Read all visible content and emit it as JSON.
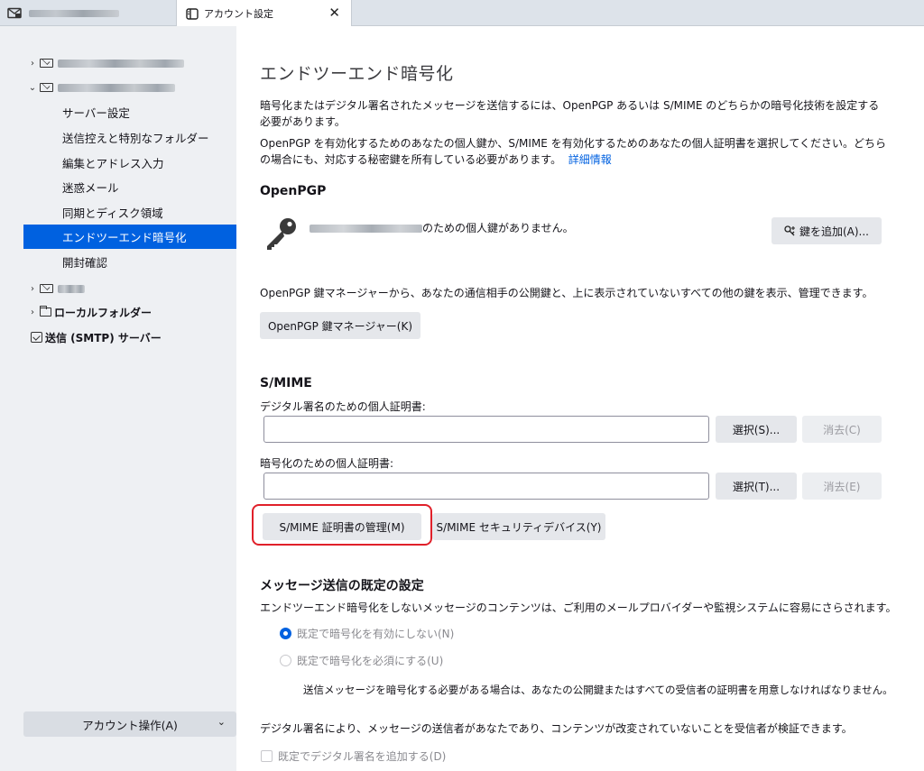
{
  "tabbar": {
    "active_tab_label": "アカウント設定",
    "close_glyph": "✕",
    "icons": {
      "first_tab": "mail-icon",
      "active_tab": "settings-icon"
    }
  },
  "sidebar": {
    "sub_items": [
      {
        "label": "サーバー設定",
        "selected": false
      },
      {
        "label": "送信控えと特別なフォルダー",
        "selected": false
      },
      {
        "label": "編集とアドレス入力",
        "selected": false
      },
      {
        "label": "迷惑メール",
        "selected": false
      },
      {
        "label": "同期とディスク領域",
        "selected": false
      },
      {
        "label": "エンドツーエンド暗号化",
        "selected": true
      },
      {
        "label": "開封確認",
        "selected": false
      }
    ],
    "local_folders_label": "ローカルフォルダー",
    "smtp_label": "送信 (SMTP) サーバー",
    "account_actions_label": "アカウント操作(A)",
    "account_actions_chevron": "⌄"
  },
  "main": {
    "title": "エンドツーエンド暗号化",
    "intro_line1": "暗号化またはデジタル署名されたメッセージを送信するには、OpenPGP あるいは S/MIME のどちらかの暗号化技術を設定する",
    "intro_line2": "必要があります。",
    "intro2_line1": "OpenPGP を有効化するためのあなたの個人鍵か、S/MIME を有効化するためのあなたの個人証明書を選択してください。どちら",
    "intro2_line2": "の場合にも、対応する秘密鍵を所有している必要があります。",
    "learn_more": "詳細情報",
    "openpgp": {
      "heading": "OpenPGP",
      "no_key_text": "のための個人鍵がありません。",
      "add_key_button": "鍵を追加(A)...",
      "manager_desc": "OpenPGP 鍵マネージャーから、あなたの通信相手の公開鍵と、上に表示されていないすべての他の鍵を表示、管理できます。",
      "manager_button": "OpenPGP 鍵マネージャー(K)"
    },
    "smime": {
      "heading": "S/MIME",
      "sign_cert_label": "デジタル署名のための個人証明書:",
      "sign_cert_value": "",
      "select_sign_button": "選択(S)...",
      "clear_sign_button": "消去(C)",
      "enc_cert_label": "暗号化のための個人証明書:",
      "enc_cert_value": "",
      "select_enc_button": "選択(T)...",
      "clear_enc_button": "消去(E)",
      "manage_certs_button": "S/MIME 証明書の管理(M)",
      "security_devices_button": "S/MIME セキュリティデバイス(Y)"
    },
    "defaults": {
      "heading": "メッセージ送信の既定の設定",
      "desc": "エンドツーエンド暗号化をしないメッセージのコンテンツは、ご利用のメールプロバイダーや監視システムに容易にさらされます。",
      "radio_no_encrypt": "既定で暗号化を有効にしない(N)",
      "radio_require_encrypt": "既定で暗号化を必須にする(U)",
      "require_note": "送信メッセージを暗号化する必要がある場合は、あなたの公開鍵またはすべての受信者の証明書を用意しなければなりません。",
      "signature_desc": "デジタル署名により、メッセージの送信者があなたであり、コンテンツが改変されていないことを受信者が検証できます。",
      "checkbox_sign_default": "既定でデジタル署名を追加する(D)",
      "selected_radio": "radio_no_encrypt"
    }
  },
  "colors": {
    "accent": "#0061e0",
    "highlight_ring": "#e0202a",
    "sidebar_bg": "#eef0f3"
  }
}
